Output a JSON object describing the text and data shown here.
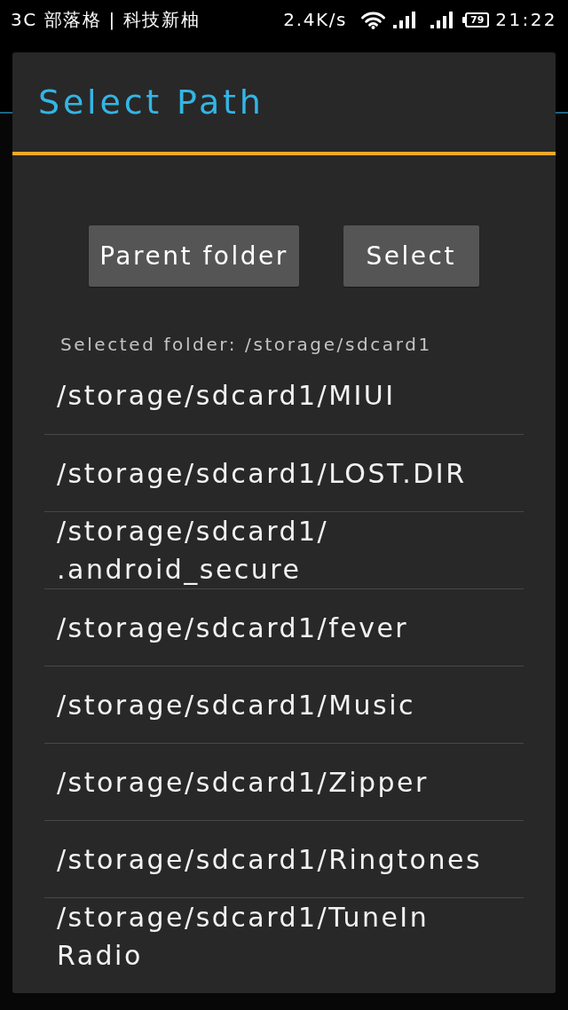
{
  "status_bar": {
    "notification": "3C 部落格 | 科技新柚",
    "speed": "2.4K/s",
    "battery": "79",
    "time": "21:22"
  },
  "dialog": {
    "title": "Select Path",
    "buttons": [
      {
        "label": "Parent folder"
      },
      {
        "label": "Select"
      }
    ],
    "selected_folder": "Selected folder: /storage/sdcard1",
    "folders": [
      "/storage/sdcard1/MIUI",
      "/storage/sdcard1/LOST.DIR",
      "/storage/sdcard1/.android_secure",
      "/storage/sdcard1/fever",
      "/storage/sdcard1/Music",
      "/storage/sdcard1/Zipper",
      "/storage/sdcard1/Ringtones",
      "/storage/sdcard1/TuneIn Radio"
    ]
  }
}
